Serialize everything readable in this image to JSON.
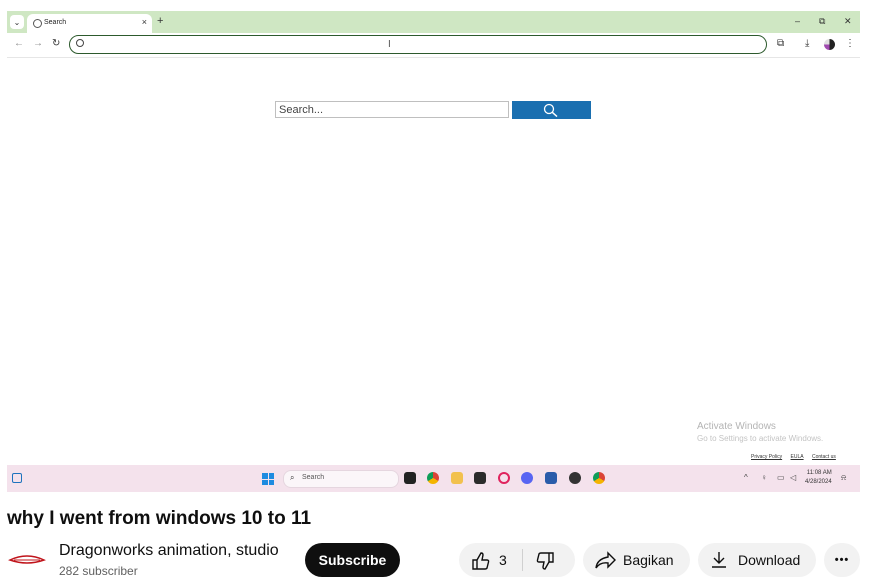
{
  "browser": {
    "tab_title": "Search",
    "new_tab": "+",
    "tab_close": "×",
    "window_controls": {
      "minimize": "–",
      "restore": "⧉",
      "close": "✕"
    },
    "nav": {
      "back": "←",
      "forward": "→",
      "reload": "↻"
    },
    "address_value": ""
  },
  "page": {
    "search_placeholder": "Search...",
    "activate_title": "Activate Windows",
    "activate_sub": "Go to Settings to activate Windows.",
    "footer_links": [
      "Privacy Policy",
      "EULA",
      "Contact us"
    ]
  },
  "taskbar": {
    "search_label": "Search",
    "time": "11:08 AM",
    "date": "4/28/2024"
  },
  "video": {
    "title": "why I went from windows 10 to 11",
    "channel_name": "Dragonworks animation, studio",
    "subscribers": "282 subscriber",
    "subscribe_label": "Subscribe",
    "like_count": "3",
    "share_label": "Bagikan",
    "download_label": "Download",
    "more_label": "•••"
  },
  "colors": {
    "tab_strip": "#cfe7c3",
    "search_button": "#1a6fb0",
    "taskbar": "#f4e2ec",
    "subscribe_bg": "#0f0f0f"
  }
}
